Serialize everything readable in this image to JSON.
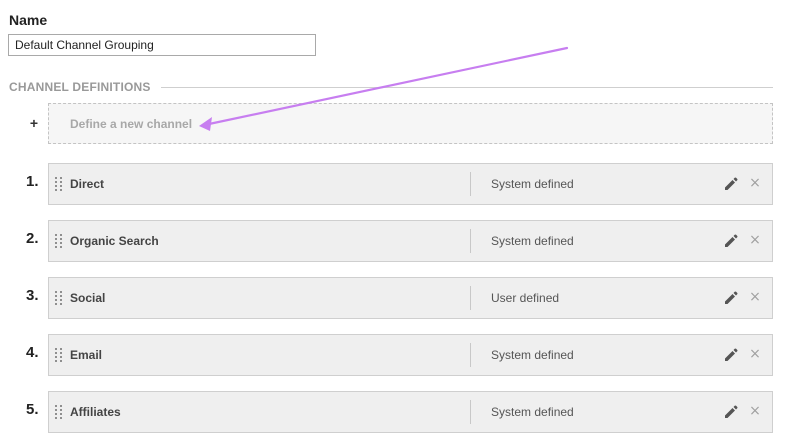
{
  "name_field": {
    "label": "Name",
    "value": "Default Channel Grouping"
  },
  "channel_definitions": {
    "heading": "CHANNEL DEFINITIONS",
    "add_symbol": "+",
    "define_new_label": "Define a new channel"
  },
  "channels": [
    {
      "number": "1.",
      "name": "Direct",
      "type": "System defined"
    },
    {
      "number": "2.",
      "name": "Organic Search",
      "type": "System defined"
    },
    {
      "number": "3.",
      "name": "Social",
      "type": "User defined"
    },
    {
      "number": "4.",
      "name": "Email",
      "type": "System defined"
    },
    {
      "number": "5.",
      "name": "Affiliates",
      "type": "System defined"
    }
  ],
  "icons": {
    "drag": "drag-handle-icon",
    "edit": "pencil-icon",
    "delete": "close-icon",
    "delete_glyph": "×"
  },
  "colors": {
    "annotation_arrow": "#c77ef0",
    "row_background": "#efefef",
    "section_heading": "#999999"
  }
}
